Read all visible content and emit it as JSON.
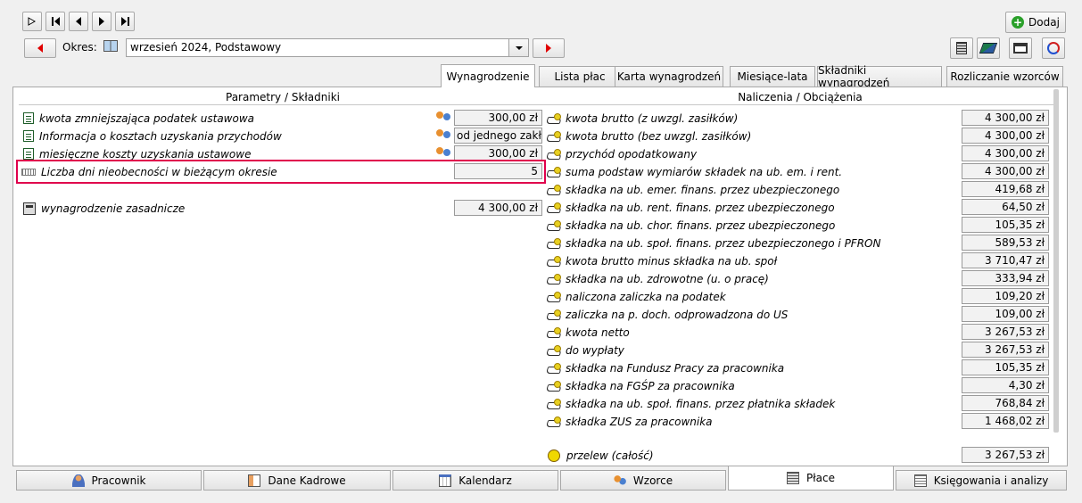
{
  "toolbar": {
    "add_label": "Dodaj",
    "period_label": "Okres:",
    "period_value": "wrzesień 2024, Podstawowy"
  },
  "tabs": [
    {
      "label": "Wynagrodzenie",
      "active": true
    },
    {
      "label": "Lista płac"
    },
    {
      "label": "Karta wynagrodzeń"
    },
    {
      "label": "Miesiące-lata"
    },
    {
      "label": "Składniki wynagrodzeń"
    },
    {
      "label": "Rozliczanie wzorców"
    }
  ],
  "left": {
    "header": "Parametry / Składniki",
    "rows": [
      {
        "label": "kwota zmniejszająca podatek ustawowa",
        "value": "300,00 zł"
      },
      {
        "label": "Informacja o kosztach uzyskania przychodów",
        "value": "od jednego zakł..."
      },
      {
        "label": "miesięczne koszty uzyskania ustawowe",
        "value": "300,00 zł"
      },
      {
        "label": "Liczba dni nieobecności w bieżącym okresie",
        "value": "5"
      },
      {
        "label": "wynagrodzenie zasadnicze",
        "value": "4 300,00 zł"
      }
    ]
  },
  "right": {
    "header": "Naliczenia / Obciążenia",
    "rows": [
      {
        "label": "kwota brutto (z uwzgl. zasiłków)",
        "value": "4 300,00 zł"
      },
      {
        "label": "kwota brutto (bez uwzgl. zasiłków)",
        "value": "4 300,00 zł"
      },
      {
        "label": "przychód opodatkowany",
        "value": "4 300,00 zł"
      },
      {
        "label": "suma podstaw wymiarów składek na ub. em. i rent.",
        "value": "4 300,00 zł"
      },
      {
        "label": "składka na ub. emer. finans. przez ubezpieczonego",
        "value": "419,68 zł"
      },
      {
        "label": "składka na ub. rent. finans. przez ubezpieczonego",
        "value": "64,50 zł"
      },
      {
        "label": "składka na ub. chor. finans. przez ubezpieczonego",
        "value": "105,35 zł"
      },
      {
        "label": "składka na ub. społ. finans. przez ubezpieczonego i PFRON",
        "value": "589,53 zł"
      },
      {
        "label": "kwota brutto minus składka na ub. społ",
        "value": "3 710,47 zł"
      },
      {
        "label": "składka na ub. zdrowotne (u. o pracę)",
        "value": "333,94 zł"
      },
      {
        "label": "naliczona zaliczka na podatek",
        "value": "109,20 zł"
      },
      {
        "label": "zaliczka na p. doch. odprowadzona do US",
        "value": "109,00 zł"
      },
      {
        "label": "kwota netto",
        "value": "3 267,53 zł"
      },
      {
        "label": "do wypłaty",
        "value": "3 267,53 zł"
      },
      {
        "label": "składka na Fundusz Pracy za pracownika",
        "value": "105,35 zł"
      },
      {
        "label": "składka na FGŚP za pracownika",
        "value": "4,30 zł"
      },
      {
        "label": "składka na ub. społ. finans. przez płatnika składek",
        "value": "768,84 zł"
      },
      {
        "label": "składka ZUS za pracownika",
        "value": "1 468,02 zł"
      }
    ],
    "transfer": {
      "label": "przelew (całość)",
      "value": "3 267,53 zł"
    }
  },
  "bottom_tabs": [
    {
      "label": "Pracownik"
    },
    {
      "label": "Dane Kadrowe"
    },
    {
      "label": "Kalendarz"
    },
    {
      "label": "Wzorce"
    },
    {
      "label": "Płace",
      "active": true
    },
    {
      "label": "Księgowania i analizy"
    }
  ]
}
